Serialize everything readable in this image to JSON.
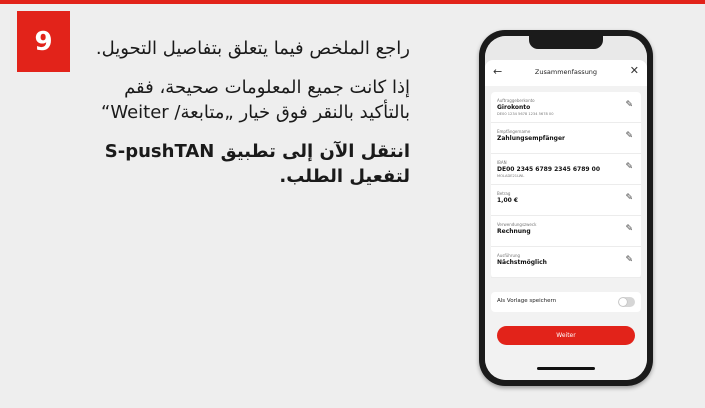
{
  "step": {
    "number": "9"
  },
  "instructions": {
    "para1": "راجع الملخص فيما يتعلق بتفاصيل التحويل.",
    "para2": "إذا كانت جميع المعلومات صحيحة، فقم بالتأكيد بالنقر فوق خيار „متابعة/ Weiter“",
    "para3": "انتقل الآن إلى تطبيق S-pushTAN لتفعيل الطلب."
  },
  "app": {
    "title": "Zusammenfassung",
    "fields": [
      {
        "label": "Auftraggeberkonto",
        "value": "Girokonto",
        "sub": "DE00 1234 5678 1234 5678 00"
      },
      {
        "label": "Empfängername",
        "value": "Zahlungsempfänger",
        "sub": ""
      },
      {
        "label": "IBAN",
        "value": "DE00 2345 6789 2345 6789 00",
        "sub": "MOLADE21LWL"
      },
      {
        "label": "Betrag",
        "value": "1,00 €",
        "sub": ""
      },
      {
        "label": "Verwendungszweck",
        "value": "Rechnung",
        "sub": ""
      },
      {
        "label": "Ausführung",
        "value": "Nächstmöglich",
        "sub": ""
      }
    ],
    "template_toggle": {
      "label": "Als Vorlage speichern",
      "on": false
    },
    "submit_label": "Weiter"
  },
  "colors": {
    "accent": "#e2231a",
    "background": "#eeeeee"
  }
}
